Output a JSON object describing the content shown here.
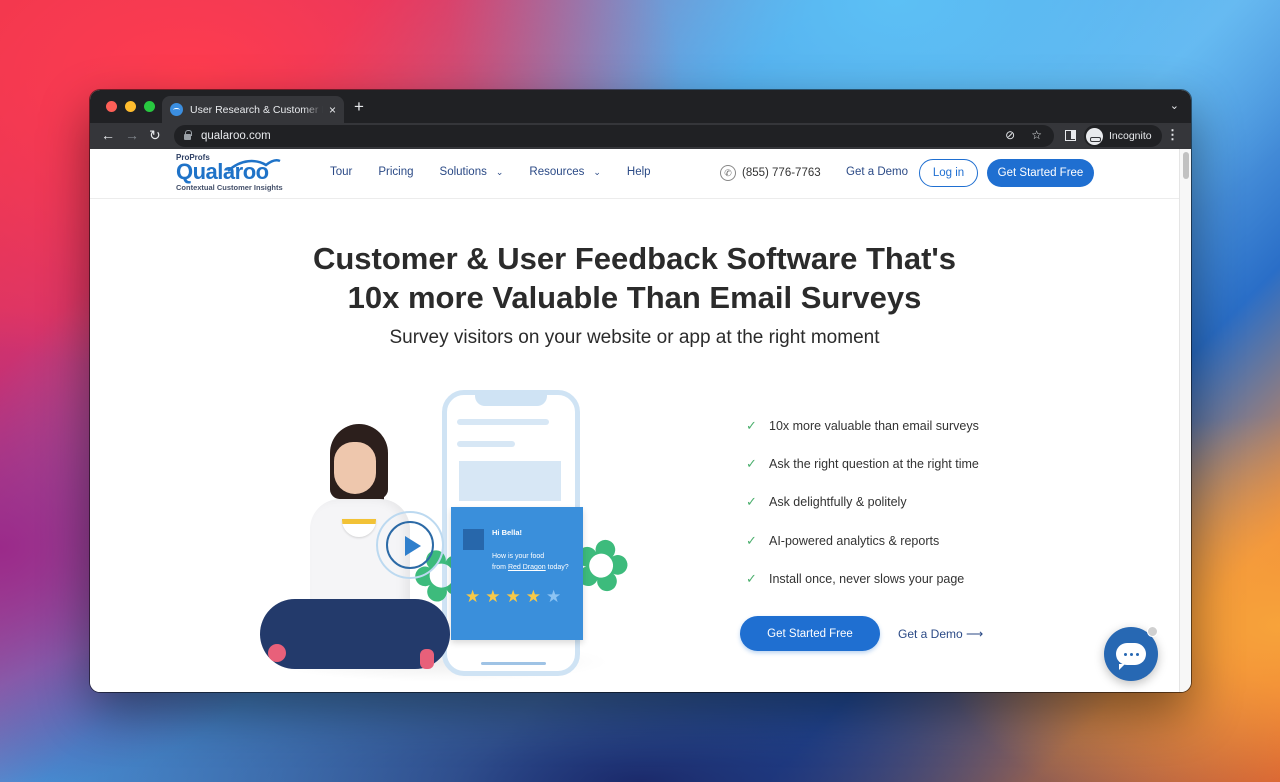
{
  "browser": {
    "tab_title": "User Research & Customer Feedback",
    "url": "qualaroo.com",
    "profile_label": "Incognito",
    "new_tab_symbol": "+",
    "tab_close_symbol": "×"
  },
  "site": {
    "logo": {
      "brand_prefix": "ProProfs",
      "name": "Qualaroo",
      "tagline": "Contextual Customer Insights"
    },
    "nav": {
      "items": [
        {
          "label": "Tour",
          "has_dropdown": false
        },
        {
          "label": "Pricing",
          "has_dropdown": false
        },
        {
          "label": "Solutions",
          "has_dropdown": true
        },
        {
          "label": "Resources",
          "has_dropdown": true
        },
        {
          "label": "Help",
          "has_dropdown": false
        }
      ],
      "phone": "(855) 776-7763",
      "demo_label": "Get a Demo",
      "login_label": "Log in",
      "cta_label": "Get Started Free"
    },
    "hero": {
      "title_line1": "Customer & User Feedback Software That's",
      "title_line2": "10x more Valuable Than Email Surveys",
      "subtitle": "Survey visitors on your website or app at the right moment",
      "features": [
        "10x more valuable than email surveys",
        "Ask the right question at the right time",
        "Ask delightfully & politely",
        "AI-powered analytics & reports",
        "Install once, never slows your page"
      ],
      "cta_primary": "Get Started Free",
      "cta_secondary": "Get a Demo ⟶"
    },
    "illustration": {
      "card_greeting": "Hi Bella!",
      "card_question_line1": "How is your food",
      "card_question_prefix": "from ",
      "card_question_highlight": "Red Dragon",
      "card_question_suffix": " today?",
      "rating": 4,
      "rating_max": 5
    }
  },
  "colors": {
    "brand_blue": "#1f6fd1",
    "nav_text": "#2b4a86",
    "check_green": "#4caf6e",
    "star_on": "#f7c948",
    "chat_bubble": "#2768b3"
  }
}
